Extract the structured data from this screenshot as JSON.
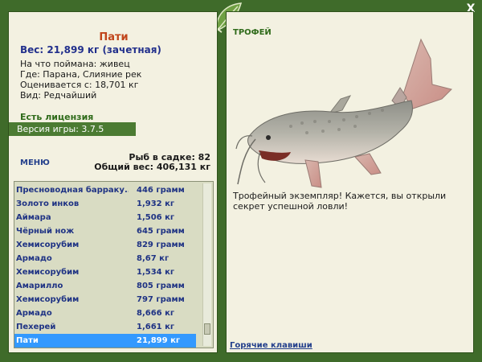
{
  "fish": {
    "title": "Пати",
    "weight_line": "Вес: 21,899 кг (зачетная)",
    "details": [
      "На что поймана: живец",
      "Где: Парана, Слияние рек",
      "Оценивается с: 18,701 кг",
      "Вид: Редчайший"
    ]
  },
  "license": "Есть лицензия",
  "version": "Версия игры: 3.7.5",
  "menu_label": "МЕНЮ",
  "cage": {
    "count_line": "Рыб в садке: 82",
    "weight_line": "Общий вес: 406,131 кг"
  },
  "catches": [
    {
      "name": "Пресноводная барраку...",
      "weight": "446 грамм"
    },
    {
      "name": "Золото инков",
      "weight": "1,932 кг"
    },
    {
      "name": "Аймара",
      "weight": "1,506 кг"
    },
    {
      "name": "Чёрный нож",
      "weight": "645 грамм"
    },
    {
      "name": "Хемисорубим",
      "weight": "829 грамм"
    },
    {
      "name": "Армадо",
      "weight": "8,67 кг"
    },
    {
      "name": "Хемисорубим",
      "weight": "1,534 кг"
    },
    {
      "name": "Амарилло",
      "weight": "805 грамм"
    },
    {
      "name": "Хемисорубим",
      "weight": "797 грамм"
    },
    {
      "name": "Армадо",
      "weight": "8,666 кг"
    },
    {
      "name": "Пехерей",
      "weight": "1,661 кг"
    },
    {
      "name": "Пати",
      "weight": "21,899 кг"
    }
  ],
  "selected_index": 11,
  "trophy": {
    "title": "ТРОФЕЙ",
    "text": "Трофейный экземпляр! Кажется, вы открыли секрет успешной ловли!"
  },
  "hotkeys": "Горячие клавиши",
  "close_glyph": "X",
  "icons": {
    "logo": "leaf-logo-icon",
    "close": "close-icon",
    "fish": "fish-picture"
  },
  "colors": {
    "frame": "#3f6b2a",
    "panel": "#f3f1e1",
    "title_accent": "#c1451b",
    "link_blue": "#24408c",
    "selection": "#3399ff"
  }
}
